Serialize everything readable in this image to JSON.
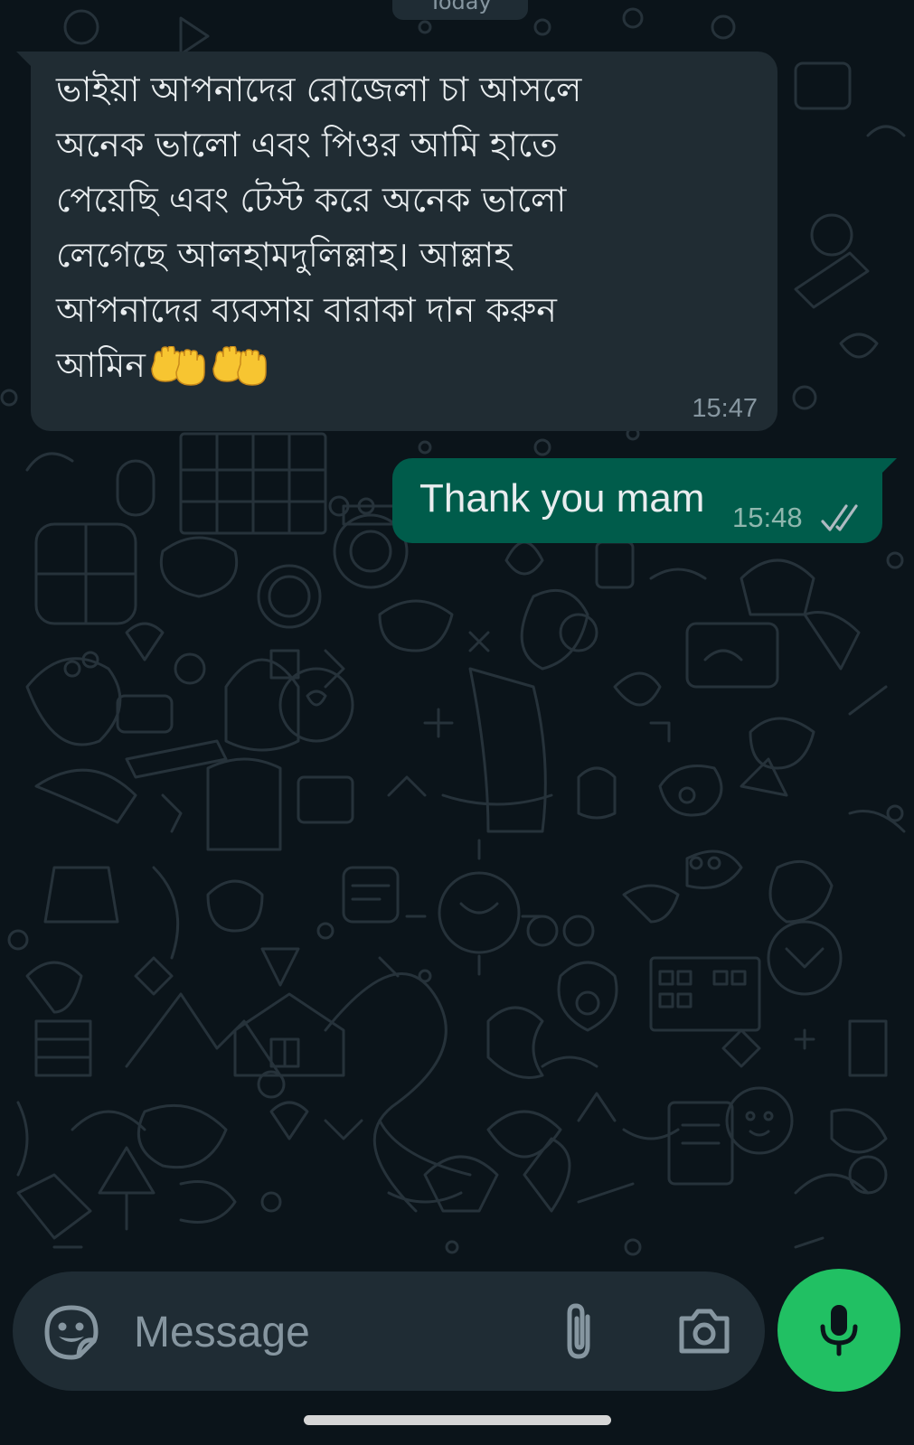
{
  "chat": {
    "date_label": "Today",
    "incoming": {
      "text": "ভাইয়া আপনাদের রোজেলা চা আসলে\nঅনেক ভালো এবং পিওর আমি হাতে\nপেয়েছি এবং টেস্ট করে অনেক ভালো\nলেগেছে আলহামদুলিল্লাহ। আল্লাহ\nআপনাদের ব্যবসায় বারাকা দান করুন\nআমিন",
      "emoji": "🤲🤲",
      "time": "15:47"
    },
    "outgoing": {
      "text": "Thank you mam",
      "time": "15:48",
      "status": "read"
    }
  },
  "composer": {
    "placeholder": "Message"
  },
  "colors": {
    "background": "#0b141a",
    "incoming_bubble": "#202c33",
    "outgoing_bubble": "#005c4b",
    "mic_button": "#21c063",
    "input_bar": "#1f2c34"
  },
  "icons": {
    "sticker": "sticker-icon",
    "attach": "paperclip-icon",
    "camera": "camera-icon",
    "mic": "microphone-icon",
    "read_receipt": "double-check-icon"
  }
}
